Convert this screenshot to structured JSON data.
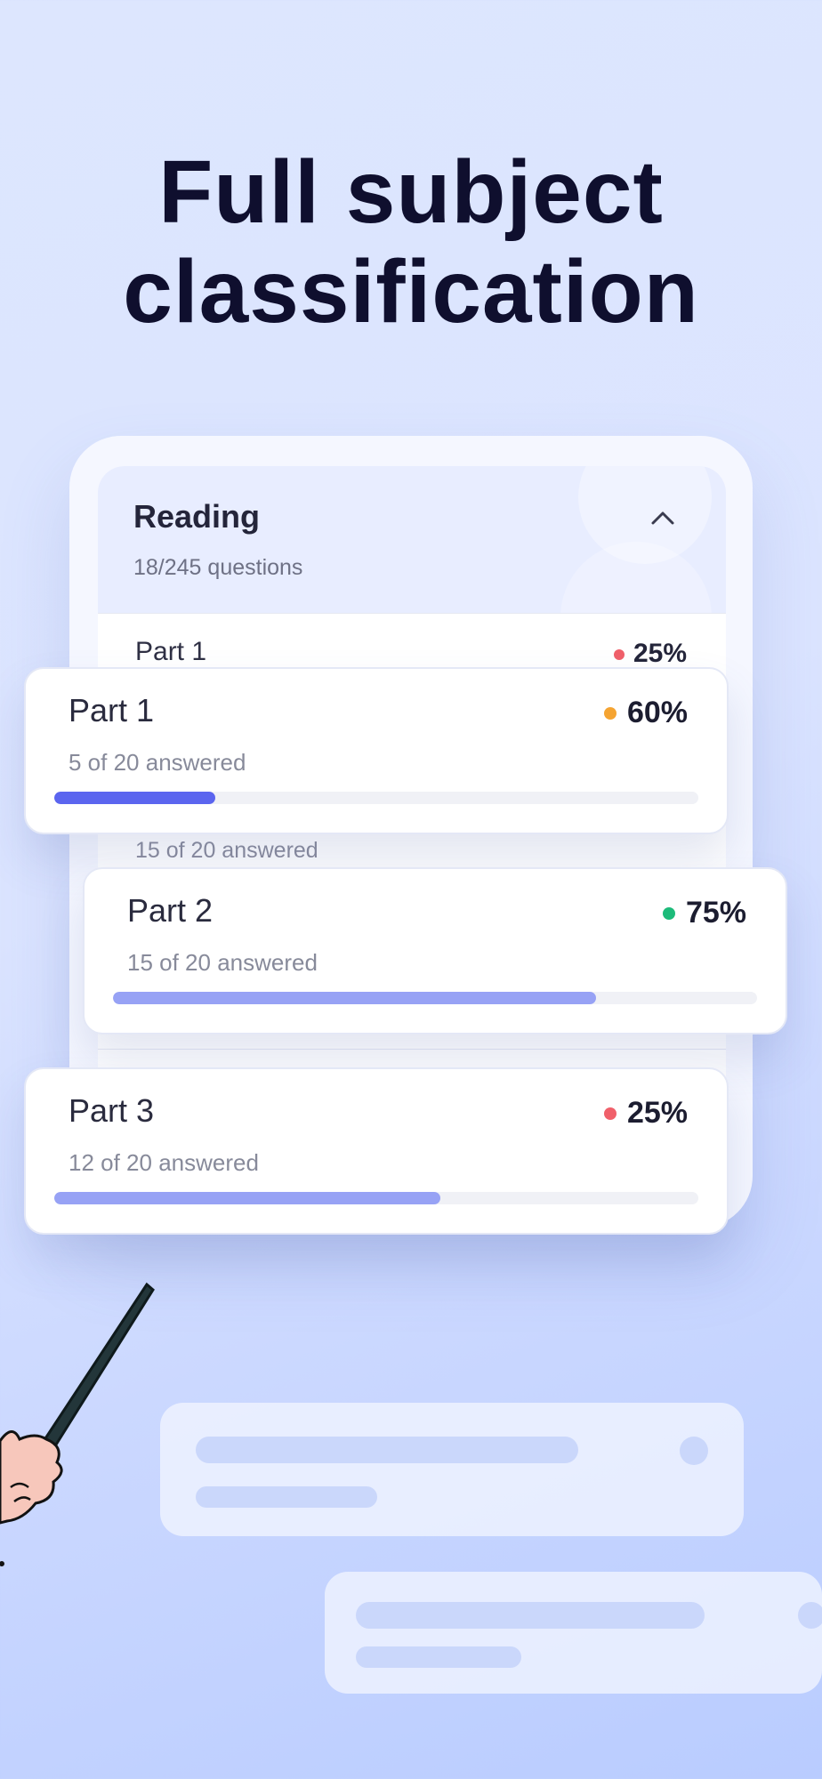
{
  "headline": {
    "line1": "Full subject",
    "line2": "classification"
  },
  "section": {
    "title": "Reading",
    "subtitle": "18/245 questions",
    "collapse_icon": "chevron-up-icon"
  },
  "background_rows": [
    {
      "label": "Part 1",
      "percent": "25%",
      "dot_color": "#f0606a"
    },
    {
      "sub": "15 of 20 answered"
    }
  ],
  "cards": [
    {
      "title": "Part 1",
      "answered": "5 of 20 answered",
      "percent": "60%",
      "dot_color": "#f5a432",
      "progress": 0.25,
      "bar_color": "#5b65ef"
    },
    {
      "title": "Part 2",
      "answered": "15 of 20 answered",
      "percent": "75%",
      "dot_color": "#1dbb7a",
      "progress": 0.75,
      "bar_color": "#97a2f5"
    },
    {
      "title": "Part 3",
      "answered": "12 of 20 answered",
      "percent": "25%",
      "dot_color": "#f0606a",
      "progress": 0.6,
      "bar_color": "#97a2f5"
    }
  ],
  "colors": {
    "accent": "#5b65ef",
    "text_dark": "#0f0f2e"
  },
  "decor": {
    "hand_icon": "hand-pointer-icon"
  }
}
